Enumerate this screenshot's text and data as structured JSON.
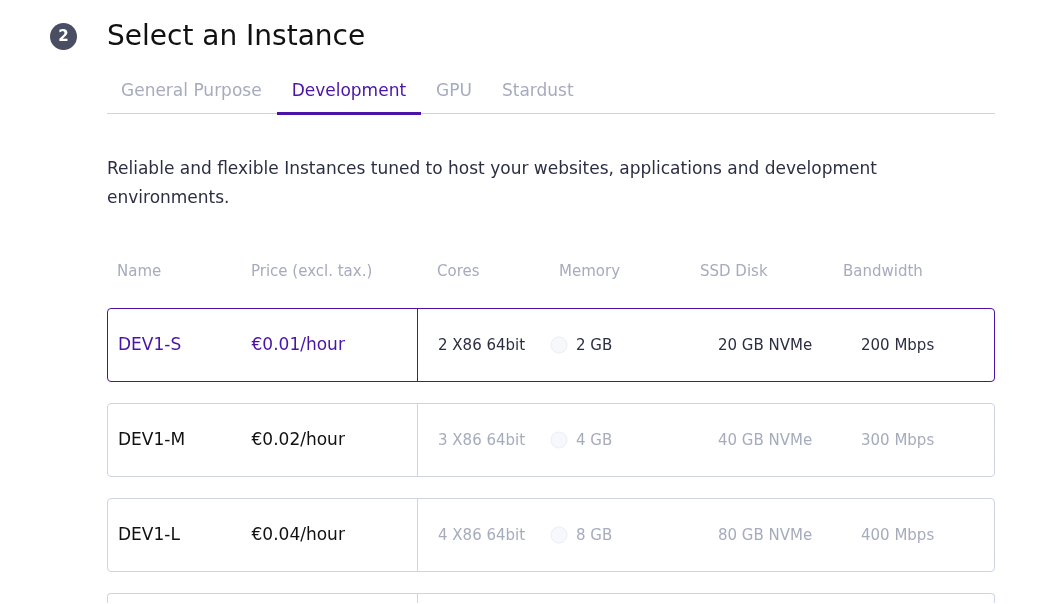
{
  "step": {
    "number": "2",
    "title": "Select an Instance"
  },
  "tabs": [
    {
      "label": "General Purpose",
      "selected": false
    },
    {
      "label": "Development",
      "selected": true
    },
    {
      "label": "GPU",
      "selected": false
    },
    {
      "label": "Stardust",
      "selected": false
    }
  ],
  "description": "Reliable and flexible Instances tuned to host your websites, applications and development environments.",
  "table": {
    "columns": [
      "Name",
      "Price (excl. tax.)",
      "Cores",
      "Memory",
      "SSD Disk",
      "Bandwidth"
    ],
    "rows": [
      {
        "name": "DEV1-S",
        "price": "€0.01/hour",
        "cores": "2 X86 64bit",
        "memory": "2 GB",
        "disk": "20 GB NVMe",
        "bandwidth": "200 Mbps",
        "selected": true
      },
      {
        "name": "DEV1-M",
        "price": "€0.02/hour",
        "cores": "3 X86 64bit",
        "memory": "4 GB",
        "disk": "40 GB NVMe",
        "bandwidth": "300 Mbps",
        "selected": false
      },
      {
        "name": "DEV1-L",
        "price": "€0.04/hour",
        "cores": "4 X86 64bit",
        "memory": "8 GB",
        "disk": "80 GB NVMe",
        "bandwidth": "400 Mbps",
        "selected": false
      }
    ]
  }
}
